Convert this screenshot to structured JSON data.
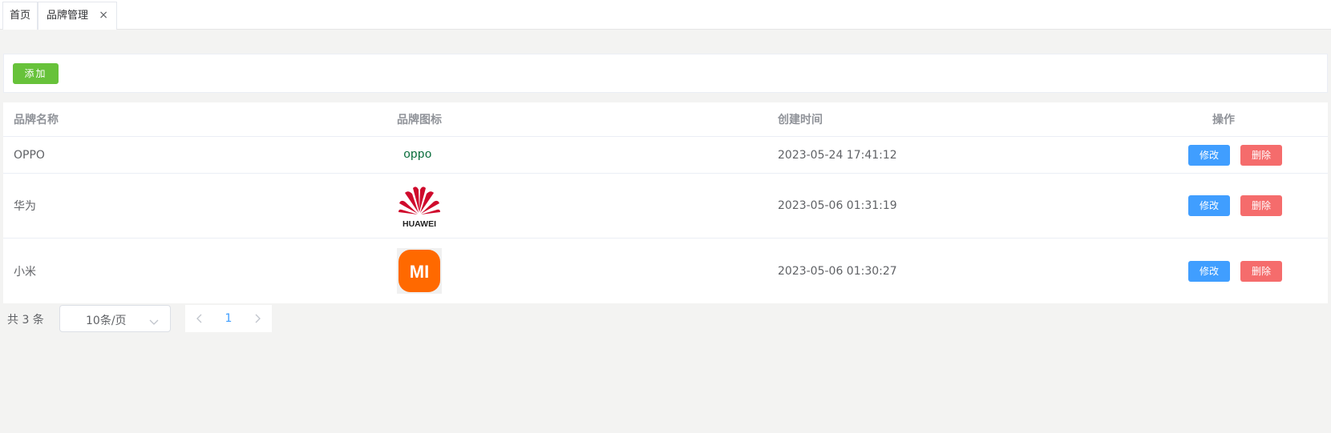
{
  "tabs": [
    {
      "label": "首页"
    },
    {
      "label": "品牌管理",
      "close": "×"
    }
  ],
  "toolbar": {
    "add_label": "添加"
  },
  "table": {
    "headers": [
      "品牌名称",
      "品牌图标",
      "创建时间",
      "操作"
    ],
    "rows": [
      {
        "name": "OPPO",
        "icon": "oppo-logo",
        "created": "2023-05-24 17:41:12",
        "edit": "修改",
        "delete": "删除"
      },
      {
        "name": "华为",
        "icon": "huawei-logo",
        "created": "2023-05-06 01:31:19",
        "edit": "修改",
        "delete": "删除"
      },
      {
        "name": "小米",
        "icon": "mi-logo",
        "created": "2023-05-06 01:30:27",
        "edit": "修改",
        "delete": "删除"
      }
    ]
  },
  "logos": {
    "oppo": "oppo",
    "huawei": "HUAWEI",
    "mi": "MI"
  },
  "pagination": {
    "total": "共 3 条",
    "page_size": "10条/页",
    "current_page": "1"
  },
  "colors": {
    "add": "#67c23a",
    "edit": "#409eff",
    "delete": "#f56c6c",
    "oppo": "#046a38",
    "huawei": "#cf0a2c",
    "mi": "#ff6900"
  }
}
